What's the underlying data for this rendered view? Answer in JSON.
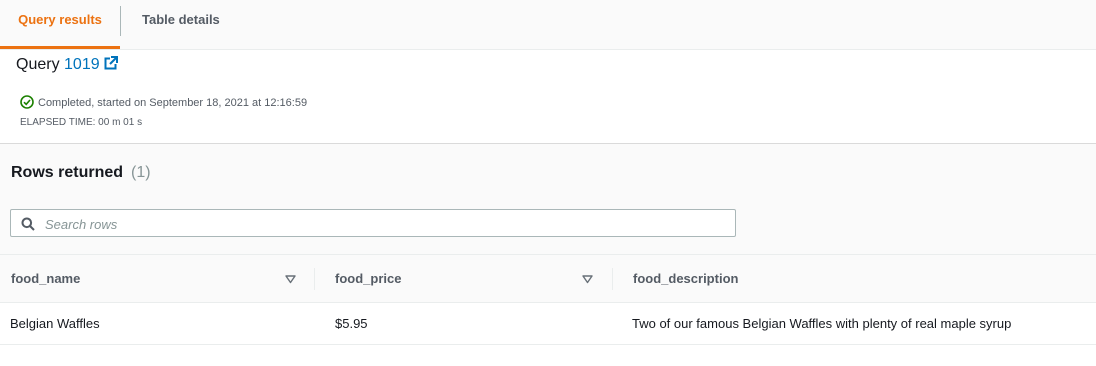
{
  "tabs": [
    {
      "label": "Query results",
      "active": true
    },
    {
      "label": "Table details",
      "active": false
    }
  ],
  "query": {
    "prefix": "Query",
    "id": "1019",
    "status": "Completed, started on September 18, 2021 at 12:16:59",
    "elapsed": "ELAPSED TIME: 00 m 01 s"
  },
  "rows": {
    "title": "Rows returned",
    "count": "(1)"
  },
  "search": {
    "placeholder": "Search rows",
    "value": ""
  },
  "table": {
    "columns": [
      "food_name",
      "food_price",
      "food_description"
    ],
    "rows": [
      [
        "Belgian Waffles",
        "$5.95",
        "Two of our famous Belgian Waffles with plenty of real maple syrup"
      ]
    ]
  },
  "colors": {
    "accent": "#ec7211",
    "link": "#0073bb",
    "success": "#1d8102"
  }
}
